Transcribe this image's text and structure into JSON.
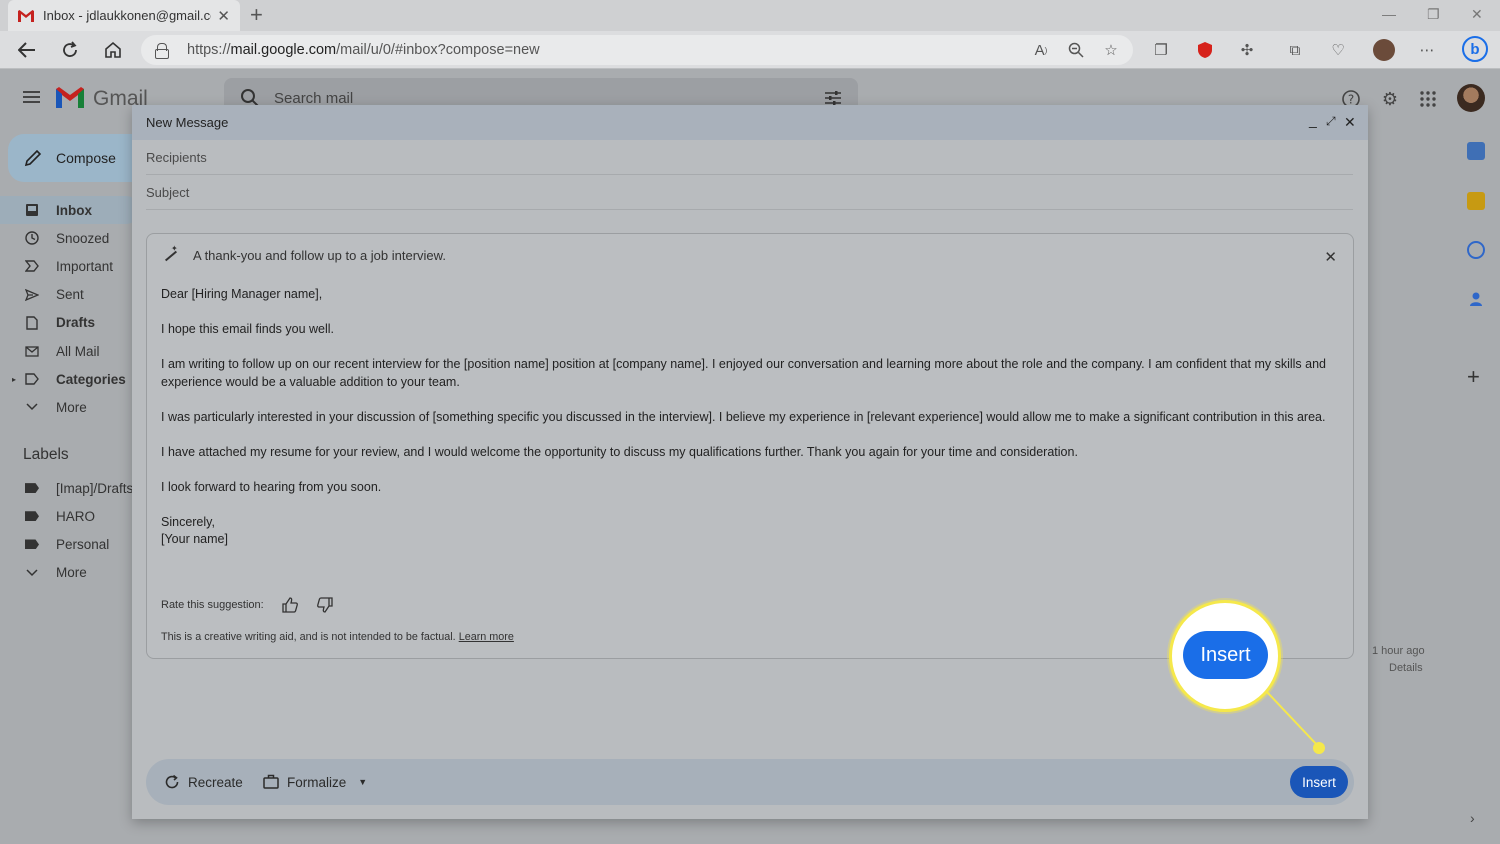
{
  "browser": {
    "tab_title": "Inbox - jdlaukkonen@gmail.com",
    "url_prefix": "https://",
    "url_host": "mail.google.com",
    "url_path": "/mail/u/0/#inbox?compose=new"
  },
  "gmail": {
    "logo_text": "Gmail",
    "search_placeholder": "Search mail",
    "compose_label": "Compose",
    "nav": [
      {
        "label": "Inbox",
        "icon": "inbox-icon"
      },
      {
        "label": "Snoozed",
        "icon": "clock-icon"
      },
      {
        "label": "Important",
        "icon": "important-icon"
      },
      {
        "label": "Sent",
        "icon": "send-icon"
      },
      {
        "label": "Drafts",
        "icon": "draft-icon"
      },
      {
        "label": "All Mail",
        "icon": "all-mail-icon"
      },
      {
        "label": "Categories",
        "icon": "label-icon"
      },
      {
        "label": "More",
        "icon": "chevron-down-icon"
      }
    ],
    "labels_heading": "Labels",
    "labels": [
      {
        "label": "[Imap]/Drafts"
      },
      {
        "label": "HARO"
      },
      {
        "label": "Personal"
      },
      {
        "label": "More"
      }
    ],
    "bg_time": "1 hour ago",
    "bg_details": "Details"
  },
  "compose": {
    "title": "New Message",
    "recipients_placeholder": "Recipients",
    "subject_placeholder": "Subject",
    "prompt": "A thank-you and follow up to a job interview.",
    "letter": [
      "Dear [Hiring Manager name],",
      "I hope this email finds you well.",
      "I am writing to follow up on our recent interview for the [position name] position at [company name]. I enjoyed our conversation and learning more about the role and the company. I am confident that my skills and experience would be a valuable addition to your team.",
      "I was particularly interested in your discussion of [something specific you discussed in the interview]. I believe my experience in [relevant experience] would allow me to make a significant contribution in this area.",
      "I have attached my resume for your review, and I would welcome the opportunity to discuss my qualifications further. Thank you again for your time and consideration.",
      "I look forward to hearing from you soon.",
      "Sincerely,",
      "[Your name]"
    ],
    "rate_label": "Rate this suggestion:",
    "disclaimer": "This is a creative writing aid, and is not intended to be factual.",
    "learn_more": "Learn more",
    "recreate_label": "Recreate",
    "formalize_label": "Formalize",
    "insert_label": "Insert"
  },
  "callout": {
    "label": "Insert",
    "color": "#f5e84b"
  },
  "colors": {
    "insert_blue": "#1a56b8",
    "callout_blue": "#1a6ee8"
  }
}
